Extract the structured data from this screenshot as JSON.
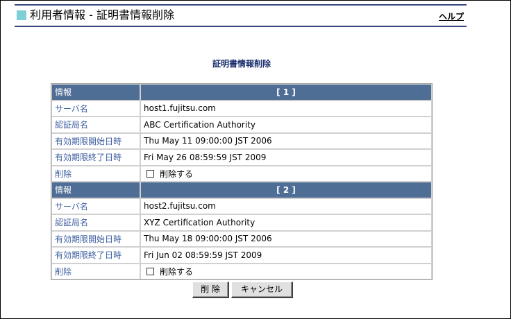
{
  "header": {
    "title": "利用者情報 - 証明書情報削除",
    "help_label": "ヘルプ"
  },
  "page_heading": "証明書情報削除",
  "certificates": [
    {
      "section_label": "情報",
      "number_label": "[ 1 ]",
      "server_label": "サーバ名",
      "server_value": "host1.fujitsu.com",
      "ca_label": "認証局名",
      "ca_value": "ABC Certification Authority",
      "valid_from_label": "有効期限開始日時",
      "valid_from_value": "Thu May 11 09:00:00 JST 2006",
      "valid_to_label": "有効期限終了日時",
      "valid_to_value": "Fri May 26 08:59:59 JST 2009",
      "delete_label": "削除",
      "delete_checkbox_label": "削除する",
      "delete_checked": false
    },
    {
      "section_label": "情報",
      "number_label": "[ 2 ]",
      "server_label": "サーバ名",
      "server_value": "host2.fujitsu.com",
      "ca_label": "認証局名",
      "ca_value": "XYZ Certification Authority",
      "valid_from_label": "有効期限開始日時",
      "valid_from_value": "Thu May 18 09:00:00 JST 2006",
      "valid_to_label": "有効期限終了日時",
      "valid_to_value": "Fri Jun 02 08:59:59 JST 2009",
      "delete_label": "削除",
      "delete_checkbox_label": "削除する",
      "delete_checked": false
    }
  ],
  "buttons": {
    "delete_label": "削 除",
    "cancel_label": "キャンセル"
  },
  "colors": {
    "header_accent": "#7fcfd6",
    "header_rule": "#3a4b7b",
    "table_header_bg": "#4f6e96",
    "label_text": "#3d5fa0",
    "heading_text": "#1a2e6e"
  }
}
